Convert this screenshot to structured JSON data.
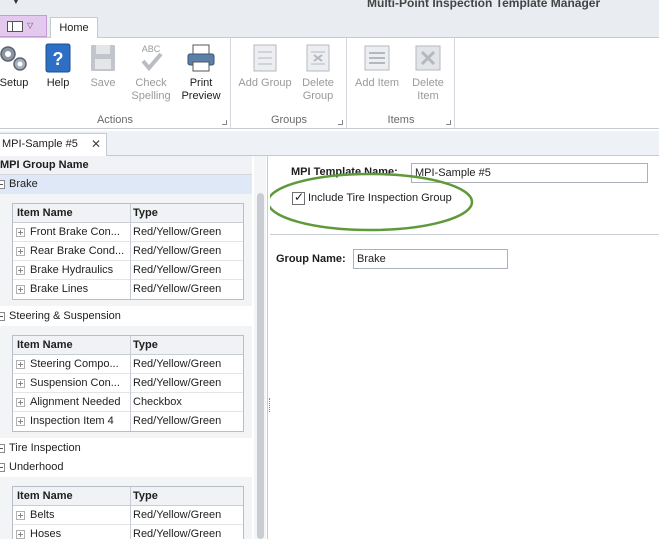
{
  "window": {
    "title": "Multi-Point Inspection Template Manager"
  },
  "ribbon": {
    "tabs": [
      {
        "label": "Home"
      }
    ],
    "groups": {
      "actions": {
        "label": "Actions",
        "buttons": {
          "setup": "Setup",
          "help": "Help",
          "save": "Save",
          "check_spelling": "Check Spelling",
          "print_preview": "Print Preview"
        }
      },
      "groups": {
        "label": "Groups",
        "buttons": {
          "add_group": "Add Group",
          "delete_group": "Delete Group"
        }
      },
      "items": {
        "label": "Items",
        "buttons": {
          "add_item": "Add Item",
          "delete_item": "Delete Item"
        }
      }
    }
  },
  "document_tab": {
    "label": "MPI-Sample  #5",
    "close": "✕"
  },
  "left_panel": {
    "header": "MPI Group Name",
    "columns": {
      "item_name": "Item Name",
      "type": "Type"
    },
    "groups": [
      {
        "name": "Brake",
        "items": [
          {
            "name": "Front Brake Con...",
            "type": "Red/Yellow/Green"
          },
          {
            "name": "Rear Brake Cond...",
            "type": "Red/Yellow/Green"
          },
          {
            "name": "Brake Hydraulics",
            "type": "Red/Yellow/Green"
          },
          {
            "name": "Brake Lines",
            "type": "Red/Yellow/Green"
          }
        ]
      },
      {
        "name": "Steering & Suspension",
        "items": [
          {
            "name": "Steering Compo...",
            "type": "Red/Yellow/Green"
          },
          {
            "name": "Suspension Con...",
            "type": "Red/Yellow/Green"
          },
          {
            "name": "Alignment Needed",
            "type": "Checkbox"
          },
          {
            "name": "Inspection Item 4",
            "type": "Red/Yellow/Green"
          }
        ]
      },
      {
        "name": "Tire Inspection",
        "items": []
      },
      {
        "name": "Underhood",
        "items": [
          {
            "name": "Belts",
            "type": "Red/Yellow/Green"
          },
          {
            "name": "Hoses",
            "type": "Red/Yellow/Green"
          }
        ]
      }
    ]
  },
  "right_panel": {
    "template_name_label": "MPI Template Name:",
    "template_name_value": "MPI-Sample  #5",
    "include_tire_label": "Include Tire Inspection Group",
    "include_tire_checked": true,
    "group_name_label": "Group Name:",
    "group_name_value": "Brake"
  },
  "colors": {
    "highlight_ellipse": "#5f9a3a",
    "selected_row": "#dfe8f6",
    "app_menu": "#e3c9ee"
  }
}
